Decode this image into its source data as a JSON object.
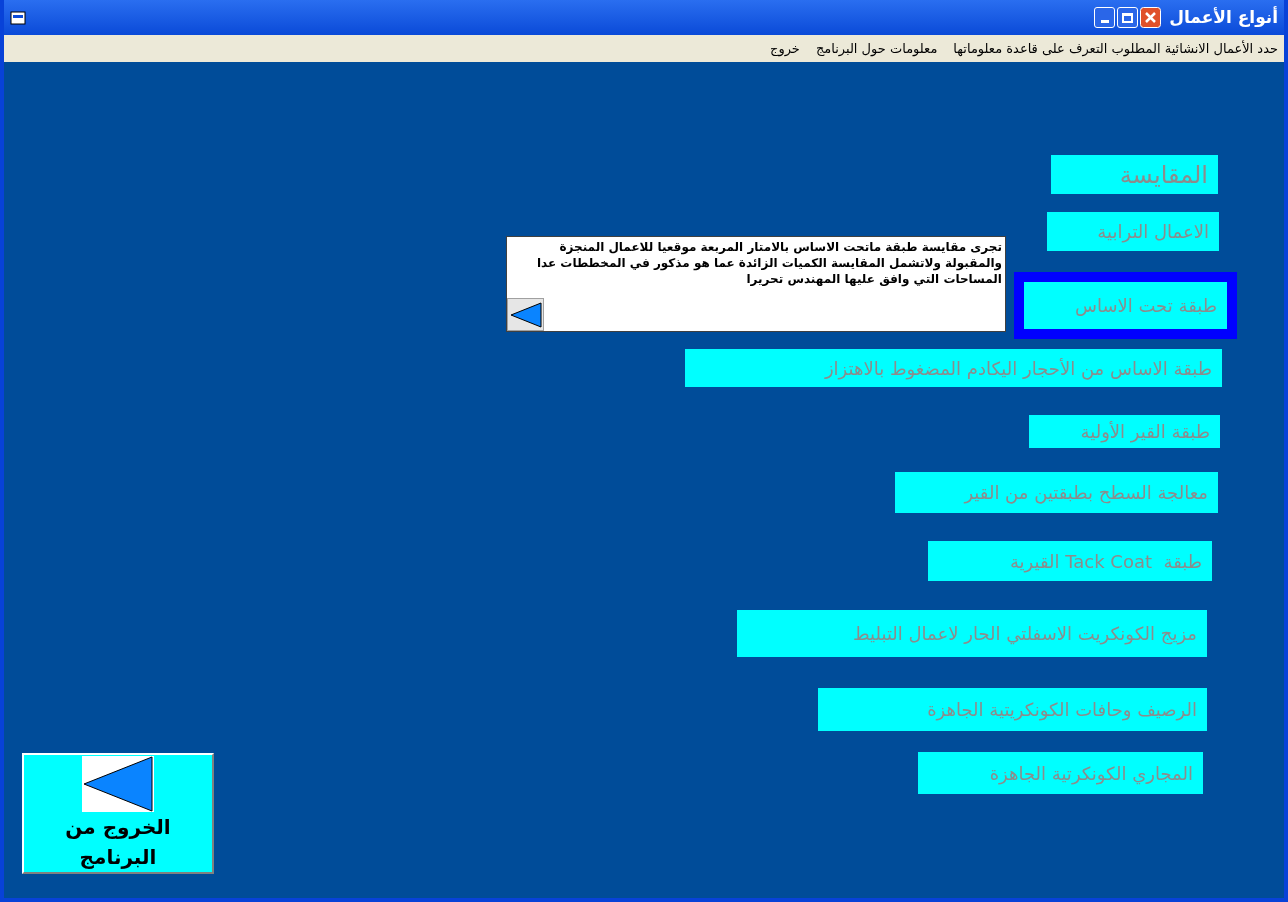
{
  "window": {
    "title": "أنواع الأعمال"
  },
  "menu": [
    "حدد الأعمال الانشائية المطلوب التعرف على قاعدة معلوماتها",
    "معلومات حول البرنامج",
    "خروج"
  ],
  "items": [
    {
      "label": "المقايسة",
      "selected": false
    },
    {
      "label": "الاعمال الترابية",
      "selected": false
    },
    {
      "label": "طبقة تحت الاساس",
      "selected": true
    },
    {
      "label": "طبقة الاساس من الأحجار اليكادم المضغوط بالاهتزاز",
      "selected": false
    },
    {
      "label": "طبقة القير الأولية",
      "selected": false
    },
    {
      "label": "معالجة السطح بطبقتين من القير",
      "selected": false
    },
    {
      "label": "طبقة  Tack Coat القيرية",
      "selected": false
    },
    {
      "label": "مزيج الكونكريت الاسفلتي الحار لاعمال التبليط",
      "selected": false
    },
    {
      "label": "الرصيف وحافات الكونكريتية الجاهزة",
      "selected": false
    },
    {
      "label": "المجاري الكونكرتية الجاهزة",
      "selected": false
    }
  ],
  "description": "تجرى مقايسة طبقة ماتحت الاساس بالامتار المربعة موقعيا للاعمال المنجزة والمقبولة ولاتشمل المقايسة الكميات الزائدة عما هو مذكور في المخططات عدا المساحات التي وافق عليها المهندس تحريرا",
  "exit_button": "الخروج من البرنامج"
}
